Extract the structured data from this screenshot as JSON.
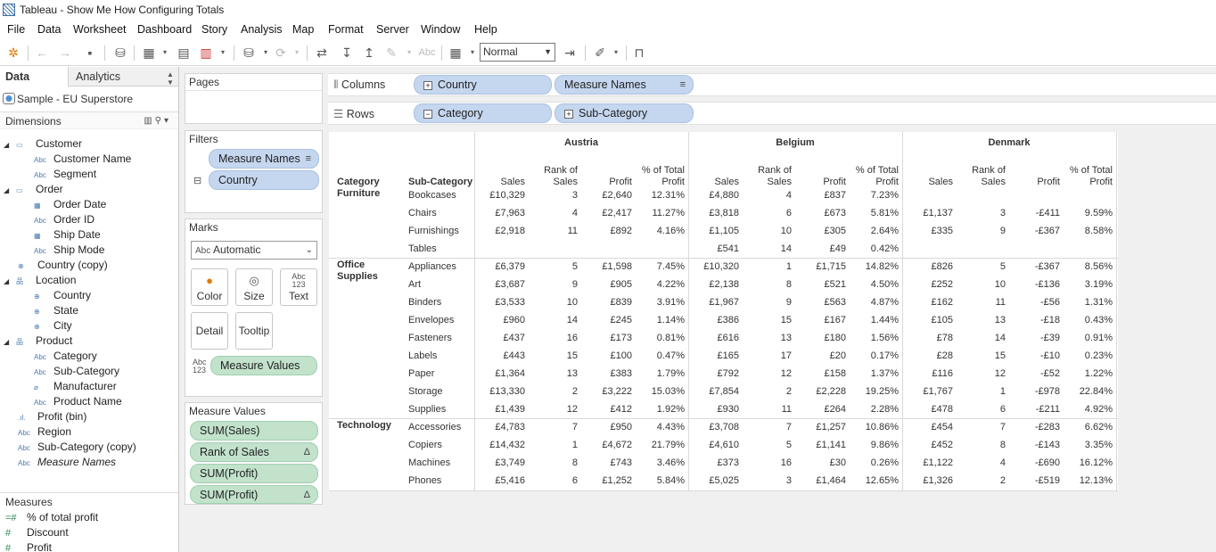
{
  "window": {
    "title": "Tableau - Show Me How Configuring Totals"
  },
  "menu": [
    "File",
    "Data",
    "Worksheet",
    "Dashboard",
    "Story",
    "Analysis",
    "Map",
    "Format",
    "Server",
    "Window",
    "Help"
  ],
  "toolbar": {
    "fit_value": "Normal"
  },
  "data_pane": {
    "tab_data": "Data",
    "tab_analytics": "Analytics",
    "datasource": "Sample - EU Superstore",
    "dimensions_label": "Dimensions",
    "dimensions": [
      {
        "label": "Customer",
        "icon": "folder-icon",
        "level": 0,
        "expand": true
      },
      {
        "label": "Customer Name",
        "icon": "abc",
        "level": 1
      },
      {
        "label": "Segment",
        "icon": "abc",
        "level": 1
      },
      {
        "label": "Order",
        "icon": "folder-icon",
        "level": 0,
        "expand": true
      },
      {
        "label": "Order Date",
        "icon": "calendar-icon",
        "level": 1
      },
      {
        "label": "Order ID",
        "icon": "abc",
        "level": 1
      },
      {
        "label": "Ship Date",
        "icon": "calendar-icon",
        "level": 1
      },
      {
        "label": "Ship Mode",
        "icon": "abc",
        "level": 1
      },
      {
        "label": "Country (copy)",
        "icon": "globe-icon",
        "level": 0
      },
      {
        "label": "Location",
        "icon": "hierarchy-icon",
        "level": 0,
        "expand": true
      },
      {
        "label": "Country",
        "icon": "globe-icon",
        "level": 1
      },
      {
        "label": "State",
        "icon": "globe-icon",
        "level": 1
      },
      {
        "label": "City",
        "icon": "globe-icon",
        "level": 1
      },
      {
        "label": "Product",
        "icon": "hierarchy-icon",
        "level": 0,
        "expand": true
      },
      {
        "label": "Category",
        "icon": "abc",
        "level": 1
      },
      {
        "label": "Sub-Category",
        "icon": "abc",
        "level": 1
      },
      {
        "label": "Manufacturer",
        "icon": "paperclip-icon",
        "level": 1
      },
      {
        "label": "Product Name",
        "icon": "abc",
        "level": 1
      },
      {
        "label": "Profit (bin)",
        "icon": "bin-icon",
        "level": 0
      },
      {
        "label": "Region",
        "icon": "abc",
        "level": 0
      },
      {
        "label": "Sub-Category (copy)",
        "icon": "abc",
        "level": 0
      },
      {
        "label": "Measure Names",
        "icon": "abc",
        "level": 0,
        "italic": true
      }
    ],
    "measures_label": "Measures",
    "measures": [
      {
        "label": "% of total profit",
        "icon": "calc-icon"
      },
      {
        "label": "Discount",
        "icon": "number-icon"
      },
      {
        "label": "Profit",
        "icon": "number-icon"
      }
    ]
  },
  "cards": {
    "pages": "Pages",
    "filters": "Filters",
    "filter_pills": [
      "Measure Names",
      "Country"
    ],
    "marks": "Marks",
    "mark_type": "Automatic",
    "mark_buttons": [
      "Color",
      "Size",
      "Text",
      "Detail",
      "Tooltip"
    ],
    "mark_field": "Measure Values",
    "measure_values": "Measure Values",
    "measure_value_pills": [
      {
        "label": "SUM(Sales)",
        "delta": false
      },
      {
        "label": "Rank of Sales",
        "delta": true
      },
      {
        "label": "SUM(Profit)",
        "delta": false
      },
      {
        "label": "SUM(Profit)",
        "delta": true
      }
    ]
  },
  "shelves": {
    "columns_label": "Columns",
    "columns": [
      "Country",
      "Measure Names"
    ],
    "rows_label": "Rows",
    "rows": [
      "Category",
      "Sub-Category"
    ]
  },
  "table": {
    "row_headers": [
      "Category",
      "Sub-Category"
    ],
    "countries": [
      "Austria",
      "Belgium",
      "Denmark"
    ],
    "measures": [
      "Sales",
      "Rank of Sales",
      "Profit",
      "% of Total Profit"
    ],
    "categories": [
      {
        "name": "Furniture",
        "rows": [
          {
            "sub": "Bookcases",
            "vals": [
              [
                "£10,329",
                "3",
                "£2,640",
                "12.31%"
              ],
              [
                "£4,880",
                "4",
                "£837",
                "7.23%"
              ],
              [
                "",
                "",
                "",
                ""
              ]
            ]
          },
          {
            "sub": "Chairs",
            "vals": [
              [
                "£7,963",
                "4",
                "£2,417",
                "11.27%"
              ],
              [
                "£3,818",
                "6",
                "£673",
                "5.81%"
              ],
              [
                "£1,137",
                "3",
                "-£411",
                "9.59%"
              ]
            ]
          },
          {
            "sub": "Furnishings",
            "vals": [
              [
                "£2,918",
                "11",
                "£892",
                "4.16%"
              ],
              [
                "£1,105",
                "10",
                "£305",
                "2.64%"
              ],
              [
                "£335",
                "9",
                "-£367",
                "8.58%"
              ]
            ]
          },
          {
            "sub": "Tables",
            "vals": [
              [
                "",
                "",
                "",
                ""
              ],
              [
                "£541",
                "14",
                "£49",
                "0.42%"
              ],
              [
                "",
                "",
                "",
                ""
              ]
            ]
          }
        ]
      },
      {
        "name": "Office Supplies",
        "rows": [
          {
            "sub": "Appliances",
            "vals": [
              [
                "£6,379",
                "5",
                "£1,598",
                "7.45%"
              ],
              [
                "£10,320",
                "1",
                "£1,715",
                "14.82%"
              ],
              [
                "£826",
                "5",
                "-£367",
                "8.56%"
              ]
            ]
          },
          {
            "sub": "Art",
            "vals": [
              [
                "£3,687",
                "9",
                "£905",
                "4.22%"
              ],
              [
                "£2,138",
                "8",
                "£521",
                "4.50%"
              ],
              [
                "£252",
                "10",
                "-£136",
                "3.19%"
              ]
            ]
          },
          {
            "sub": "Binders",
            "vals": [
              [
                "£3,533",
                "10",
                "£839",
                "3.91%"
              ],
              [
                "£1,967",
                "9",
                "£563",
                "4.87%"
              ],
              [
                "£162",
                "11",
                "-£56",
                "1.31%"
              ]
            ]
          },
          {
            "sub": "Envelopes",
            "vals": [
              [
                "£960",
                "14",
                "£245",
                "1.14%"
              ],
              [
                "£386",
                "15",
                "£167",
                "1.44%"
              ],
              [
                "£105",
                "13",
                "-£18",
                "0.43%"
              ]
            ]
          },
          {
            "sub": "Fasteners",
            "vals": [
              [
                "£437",
                "16",
                "£173",
                "0.81%"
              ],
              [
                "£616",
                "13",
                "£180",
                "1.56%"
              ],
              [
                "£78",
                "14",
                "-£39",
                "0.91%"
              ]
            ]
          },
          {
            "sub": "Labels",
            "vals": [
              [
                "£443",
                "15",
                "£100",
                "0.47%"
              ],
              [
                "£165",
                "17",
                "£20",
                "0.17%"
              ],
              [
                "£28",
                "15",
                "-£10",
                "0.23%"
              ]
            ]
          },
          {
            "sub": "Paper",
            "vals": [
              [
                "£1,364",
                "13",
                "£383",
                "1.79%"
              ],
              [
                "£792",
                "12",
                "£158",
                "1.37%"
              ],
              [
                "£116",
                "12",
                "-£52",
                "1.22%"
              ]
            ]
          },
          {
            "sub": "Storage",
            "vals": [
              [
                "£13,330",
                "2",
                "£3,222",
                "15.03%"
              ],
              [
                "£7,854",
                "2",
                "£2,228",
                "19.25%"
              ],
              [
                "£1,767",
                "1",
                "-£978",
                "22.84%"
              ]
            ]
          },
          {
            "sub": "Supplies",
            "vals": [
              [
                "£1,439",
                "12",
                "£412",
                "1.92%"
              ],
              [
                "£930",
                "11",
                "£264",
                "2.28%"
              ],
              [
                "£478",
                "6",
                "-£211",
                "4.92%"
              ]
            ]
          }
        ]
      },
      {
        "name": "Technology",
        "rows": [
          {
            "sub": "Accessories",
            "vals": [
              [
                "£4,783",
                "7",
                "£950",
                "4.43%"
              ],
              [
                "£3,708",
                "7",
                "£1,257",
                "10.86%"
              ],
              [
                "£454",
                "7",
                "-£283",
                "6.62%"
              ]
            ]
          },
          {
            "sub": "Copiers",
            "vals": [
              [
                "£14,432",
                "1",
                "£4,672",
                "21.79%"
              ],
              [
                "£4,610",
                "5",
                "£1,141",
                "9.86%"
              ],
              [
                "£452",
                "8",
                "-£143",
                "3.35%"
              ]
            ]
          },
          {
            "sub": "Machines",
            "vals": [
              [
                "£3,749",
                "8",
                "£743",
                "3.46%"
              ],
              [
                "£373",
                "16",
                "£30",
                "0.26%"
              ],
              [
                "£1,122",
                "4",
                "-£690",
                "16.12%"
              ]
            ]
          },
          {
            "sub": "Phones",
            "vals": [
              [
                "£5,416",
                "6",
                "£1,252",
                "5.84%"
              ],
              [
                "£5,025",
                "3",
                "£1,464",
                "12.65%"
              ],
              [
                "£1,326",
                "2",
                "-£519",
                "12.13%"
              ]
            ]
          }
        ]
      }
    ]
  }
}
